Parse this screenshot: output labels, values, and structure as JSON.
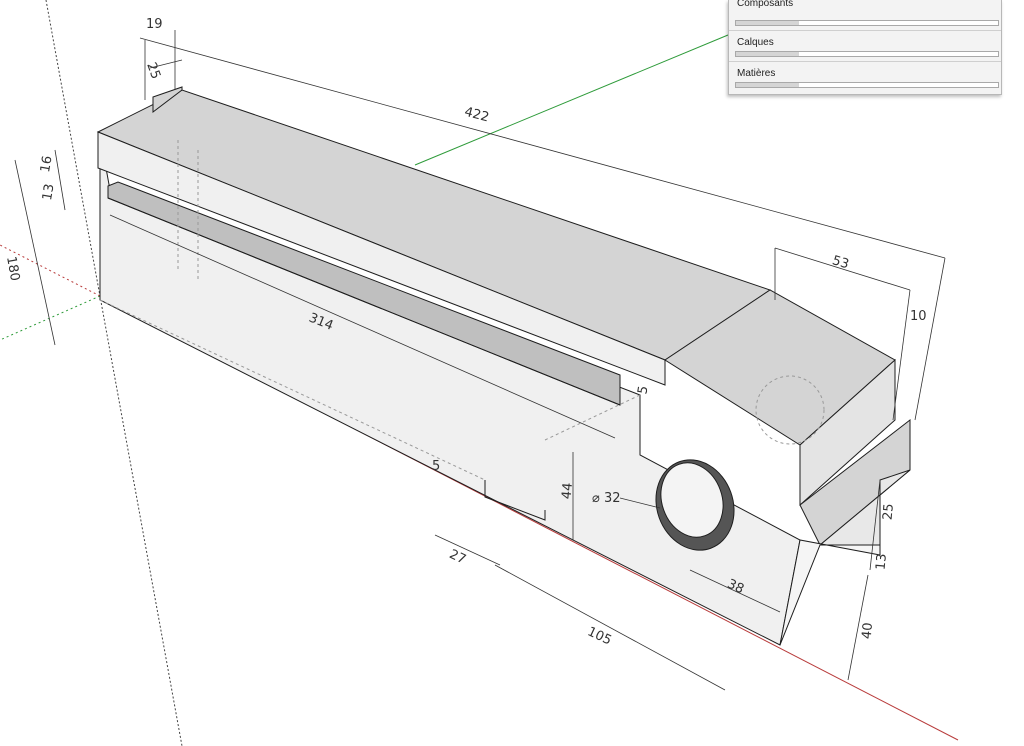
{
  "trays": [
    {
      "label": "Composants"
    },
    {
      "label": "Calques"
    },
    {
      "label": "Matières"
    }
  ],
  "dimensions": {
    "width_top": "19",
    "notch_width": "25",
    "total_length": "422",
    "lip_height": "16",
    "slot_height": "13",
    "overall_height": "180",
    "slot_length": "314",
    "end_width": "53",
    "end_offset": "10",
    "small_step": "5",
    "groove_depth": "5",
    "hole_diameter": "⌀ 32",
    "hole_height": "44",
    "groove_width": "27",
    "hole_offset": "38",
    "groove_to_end": "105",
    "step_a": "25",
    "step_b": "13",
    "base_height": "40"
  },
  "colors": {
    "axis_green": "#2e9b3a",
    "axis_red": "#b83b3b",
    "face_top": "#d4d4d4",
    "face_side": "#f0f0f0",
    "edge": "#1e1e1e"
  }
}
